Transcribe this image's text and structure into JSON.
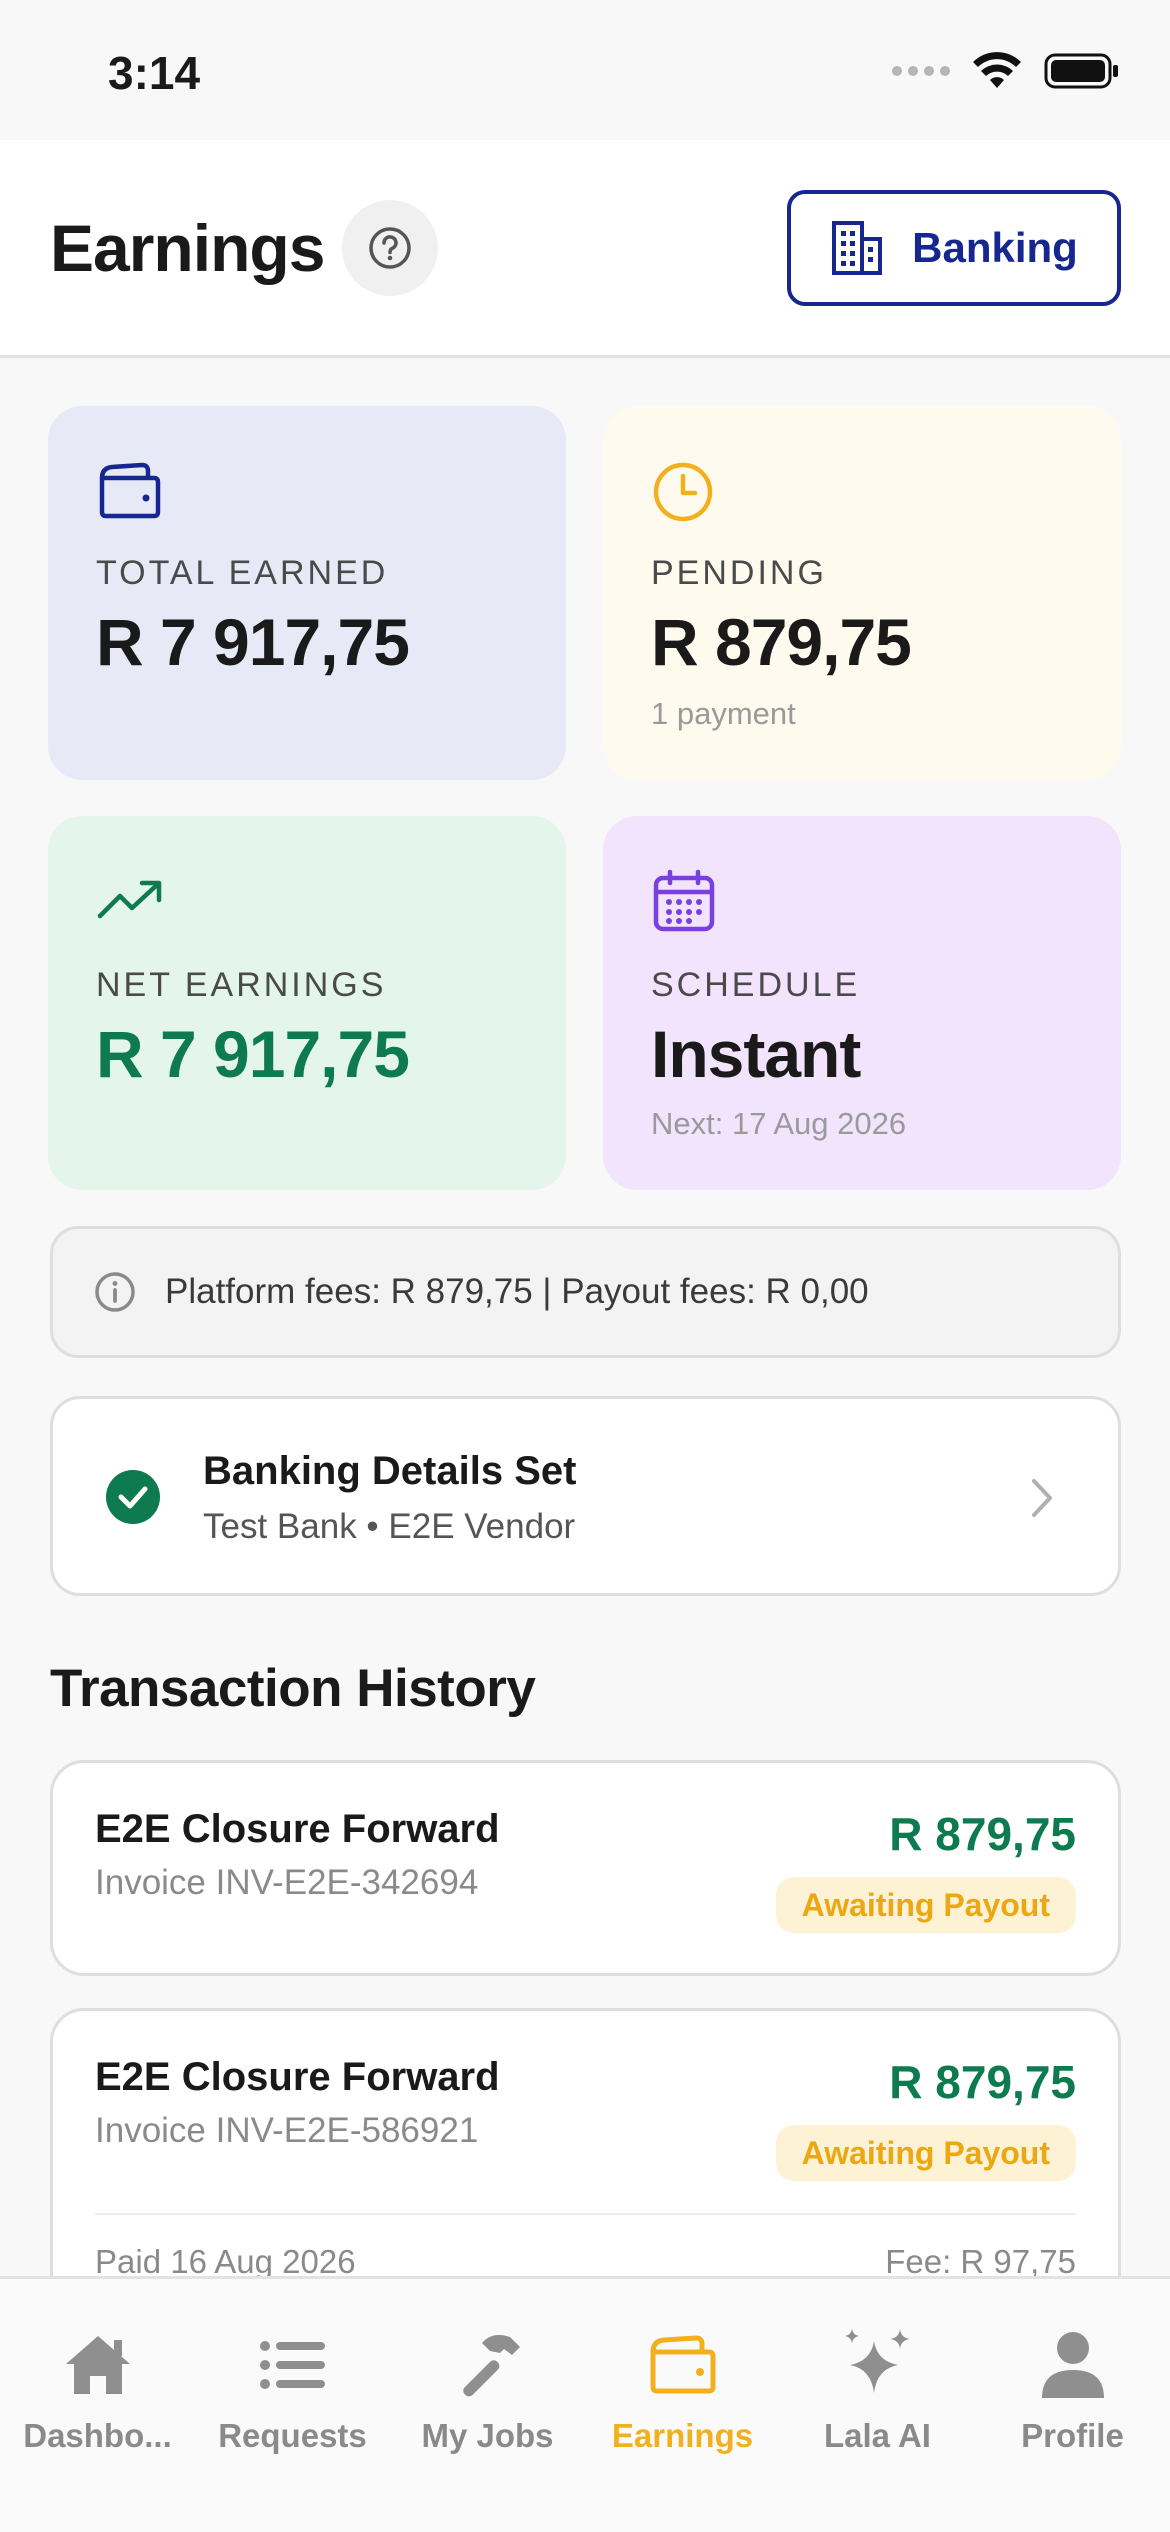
{
  "status": {
    "time": "3:14"
  },
  "header": {
    "title": "Earnings",
    "banking_label": "Banking"
  },
  "stats": {
    "total": {
      "label": "TOTAL EARNED",
      "value": "R 7 917,75"
    },
    "pending": {
      "label": "PENDING",
      "value": "R 879,75",
      "sub": "1 payment"
    },
    "net": {
      "label": "NET EARNINGS",
      "value": "R 7 917,75"
    },
    "schedule": {
      "label": "SCHEDULE",
      "value": "Instant",
      "sub": "Next: 17 Aug 2026"
    }
  },
  "fees": {
    "text": "Platform fees: R 879,75 | Payout fees: R 0,00"
  },
  "banking_details": {
    "title": "Banking Details Set",
    "subtitle": "Test Bank • E2E Vendor"
  },
  "history": {
    "title": "Transaction History",
    "items": [
      {
        "title": "E2E Closure Forward",
        "invoice": "Invoice INV-E2E-342694",
        "amount": "R 879,75",
        "status": "Awaiting Payout"
      },
      {
        "title": "E2E Closure Forward",
        "invoice": "Invoice INV-E2E-586921",
        "amount": "R 879,75",
        "status": "Awaiting Payout",
        "paid": "Paid 16 Aug 2026",
        "fee": "Fee: R 97,75"
      }
    ]
  },
  "tabs": [
    {
      "label": "Dashbo...",
      "icon": "home-icon",
      "active": false
    },
    {
      "label": "Requests",
      "icon": "list-icon",
      "active": false
    },
    {
      "label": "My Jobs",
      "icon": "hammer-icon",
      "active": false
    },
    {
      "label": "Earnings",
      "icon": "wallet-icon",
      "active": true
    },
    {
      "label": "Lala AI",
      "icon": "sparkles-icon",
      "active": false
    },
    {
      "label": "Profile",
      "icon": "person-icon",
      "active": false
    }
  ],
  "colors": {
    "brand_blue": "#16278f",
    "accent_yellow": "#f2b01e",
    "green": "#0e7a4f",
    "purple": "#7a3fe0",
    "card_total_bg": "#e7eaf6",
    "card_pending_bg": "#fffaee",
    "card_net_bg": "#e4f5ec",
    "card_schedule_bg": "#f3e4fd"
  }
}
